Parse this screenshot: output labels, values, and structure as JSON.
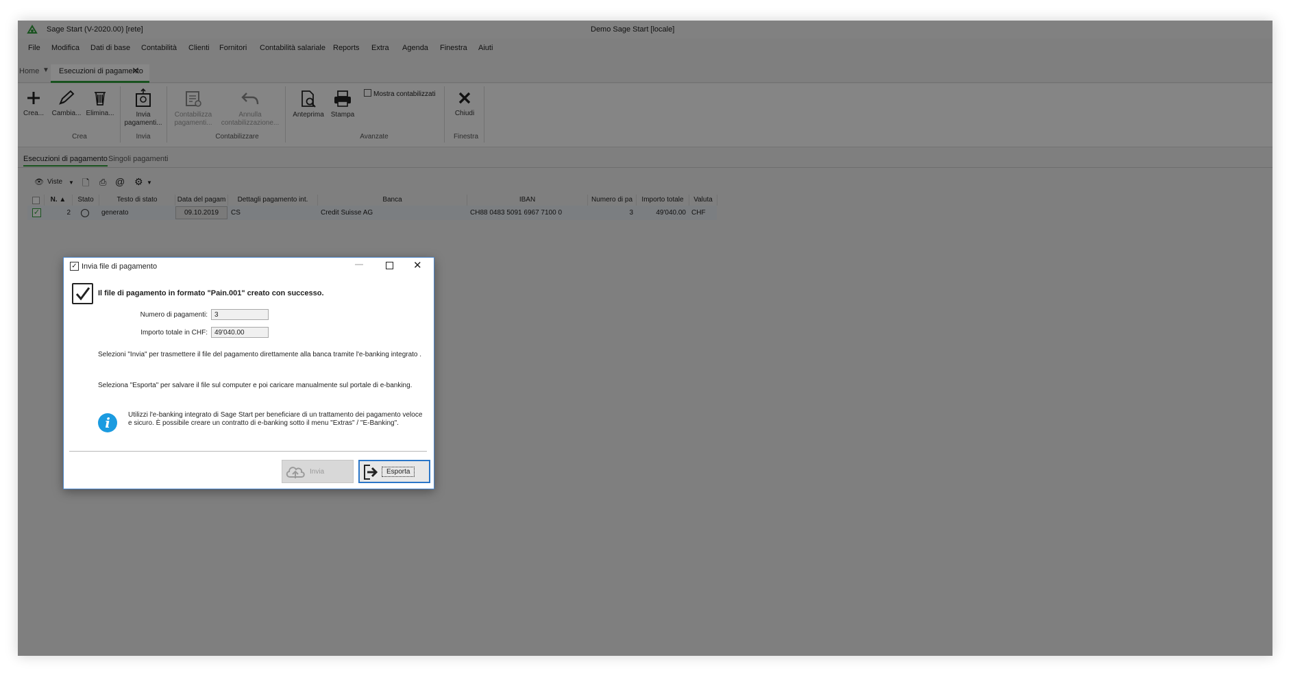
{
  "app": {
    "title": "Sage Start (V-2020.00) [rete]",
    "window_title": "Demo Sage Start [locale]"
  },
  "menu": [
    "File",
    "Modifica",
    "Dati di base",
    "Contabilità",
    "Clienti",
    "Fornitori",
    "Contabilità salariale",
    "Reports",
    "Extra",
    "Agenda",
    "Finestra",
    "Aiuti"
  ],
  "tabs": {
    "home": "Home",
    "active": "Esecuzioni di pagamento"
  },
  "ribbon": {
    "crea": "Crea...",
    "cambia": "Cambia...",
    "elimina": "Elimina...",
    "invia_1": "Invia",
    "invia_2": "pagamenti...",
    "contabilizza_1": "Contabilizza",
    "contabilizza_2": "pagamenti...",
    "annulla_1": "Annulla",
    "annulla_2": "contabilizzazione...",
    "anteprima": "Anteprima",
    "stampa": "Stampa",
    "mostra": "Mostra contabilizzati",
    "chiudi": "Chiudi",
    "groups": {
      "crea": "Crea",
      "invia": "Invia",
      "contabilizzare": "Contabilizzare",
      "avanzate": "Avanzate",
      "finestra": "Finestra"
    }
  },
  "subtabs": [
    "Esecuzioni di pagamento",
    "Singoli pagamenti"
  ],
  "grid_toolbar": {
    "viste": "Viste"
  },
  "grid": {
    "headers": [
      "N.",
      "Stato",
      "Testo di stato",
      "Data del pagam",
      "Dettagli pagamento int.",
      "Banca",
      "IBAN",
      "Numero di pa",
      "Importo totale",
      "Valuta"
    ],
    "row": {
      "n": "2",
      "stato_text": "generato",
      "data": "09.10.2019",
      "dettagli": "CS",
      "banca": "Credit Suisse AG",
      "iban": "CH88 0483 5091 6967 7100 0",
      "numero": "3",
      "importo": "49'040.00",
      "valuta": "CHF"
    }
  },
  "dialog": {
    "title": "Invia file di pagamento",
    "headline": "Il file di pagamento in formato \"Pain.001\" creato con successo.",
    "label_numero": "Numero di pagamenti:",
    "value_numero": "3",
    "label_importo": "Importo totale in CHF:",
    "value_importo": "49'040.00",
    "msg_invia": "Selezioni \"Invia\" per trasmettere il file del pagamento direttamente alla banca tramite l'e-banking integrato .",
    "msg_esporta": "Seleziona \"Esporta\" per salvare il file sul computer e poi caricare manualmente sul portale di e-banking.",
    "info_1": "Utilizzi l'e-banking integrato di Sage Start per beneficiare di un trattamento dei pagamento veloce",
    "info_2": "e sicuro. È possibile creare un contratto di e-banking  sotto il menu \"Extras\" / \"E-Banking\".",
    "btn_invia": "Invia",
    "btn_esporta": "Esporta"
  },
  "colors": {
    "accent": "#2f9b3a",
    "dialog_border": "#4a84c8",
    "info": "#1b9be0"
  }
}
